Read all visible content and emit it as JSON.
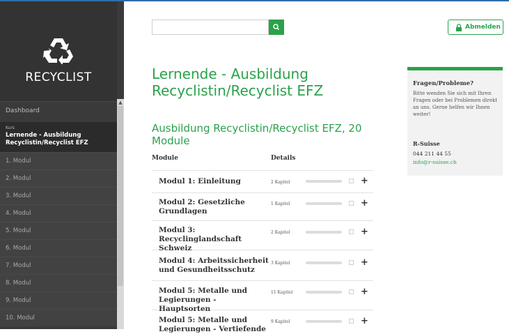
{
  "brand": {
    "name": "RECYCLIST",
    "accent": "#2aa24b"
  },
  "sidebar": {
    "dashboard": "Dashboard",
    "course_kicker": "Kurs",
    "course_title": "Lernende - Ausbildung Recyclistin/Recyclist EFZ",
    "modules": [
      "1. Modul",
      "2. Modul",
      "3. Modul",
      "4. Modul",
      "5. Modul",
      "6. Modul",
      "7. Modul",
      "8. Modul",
      "9. Modul",
      "10. Modul"
    ]
  },
  "header": {
    "search_placeholder": "",
    "search_icon": "search-icon",
    "logout_label": "Abmelden",
    "logout_icon": "lock-icon"
  },
  "main": {
    "title": "Lernende - Ausbildung Recyclistin/Recyclist EFZ",
    "subtitle": "Ausbildung Recyclistin/Recyclist EFZ, 20 Module",
    "columns": [
      "Module",
      "Details"
    ],
    "rows": [
      {
        "name": "Modul 1: Einleitung",
        "chapters": "2 Kapitel",
        "progress": 0
      },
      {
        "name": "Modul 2: Gesetzliche Grundlagen",
        "chapters": "1 Kapitel",
        "progress": 0
      },
      {
        "name": "Modul 3: Recyclinglandschaft Schweiz",
        "chapters": "2 Kapitel",
        "progress": 0
      },
      {
        "name": "Modul 4: Arbeitssicherheit und Gesundheitsschutz",
        "chapters": "3 Kapitel",
        "progress": 0
      },
      {
        "name": "Modul 5: Metalle und Legierungen - Hauptsorten",
        "chapters": "11 Kapitel",
        "progress": 0
      },
      {
        "name": "Modul 5: Metalle und Legierungen - Vertiefende",
        "chapters": "9 Kapitel",
        "progress": 0
      }
    ]
  },
  "help": {
    "title": "Fragen/Probleme?",
    "text": "Bitte wenden Sie sich mit Ihren Fragen oder bei Problemen direkt an uns. Gerne helfen wir Ihnen weiter!",
    "org": "R-Suisse",
    "phone": "044 211 44 55",
    "email": "info@r-suisse.ch"
  }
}
